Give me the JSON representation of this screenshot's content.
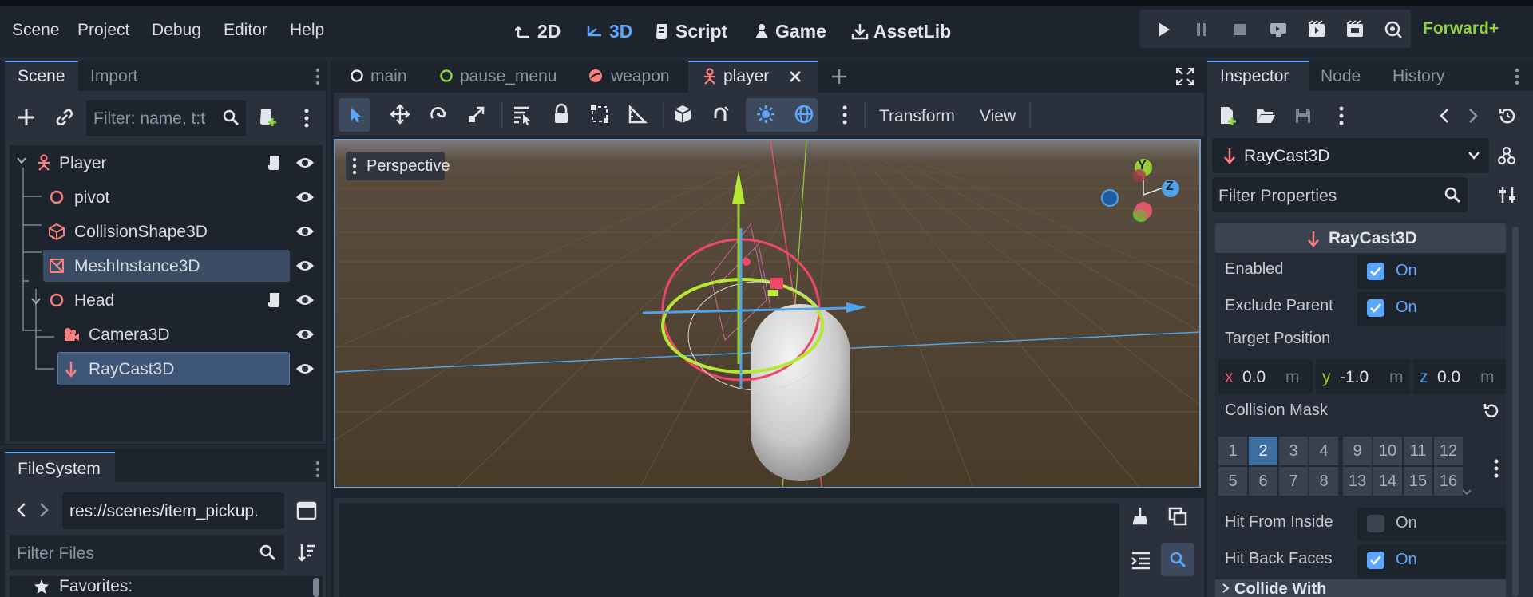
{
  "menu": [
    "Scene",
    "Project",
    "Debug",
    "Editor",
    "Help"
  ],
  "modes": {
    "m2d": "2D",
    "m3d": "3D",
    "script": "Script",
    "game": "Game",
    "assetlib": "AssetLib"
  },
  "renderer": "Forward+",
  "scene_dock": {
    "tabs": {
      "scene": "Scene",
      "import": "Import"
    },
    "filter_placeholder": "Filter: name, t:t",
    "nodes": [
      {
        "label": "Player",
        "icon": "character-body-icon"
      },
      {
        "label": "pivot",
        "icon": "node3d-icon"
      },
      {
        "label": "CollisionShape3D",
        "icon": "collision-shape-icon"
      },
      {
        "label": "MeshInstance3D",
        "icon": "mesh-instance-icon"
      },
      {
        "label": "Head",
        "icon": "node3d-icon"
      },
      {
        "label": "Camera3D",
        "icon": "camera-icon"
      },
      {
        "label": "RayCast3D",
        "icon": "raycast-icon"
      }
    ]
  },
  "filesystem": {
    "tab": "FileSystem",
    "path": "res://scenes/item_pickup.",
    "filter_placeholder": "Filter Files",
    "favorites": "Favorites:"
  },
  "scene_tabs": [
    {
      "label": "main"
    },
    {
      "label": "pause_menu"
    },
    {
      "label": "weapon"
    },
    {
      "label": "player"
    }
  ],
  "viewport": {
    "transform_menu": "Transform",
    "view_menu": "View",
    "perspective": "Perspective",
    "gizmo_axes": {
      "y": "Y",
      "z": "Z"
    }
  },
  "inspector": {
    "tabs": {
      "inspector": "Inspector",
      "node": "Node",
      "history": "History"
    },
    "node_type": "RayCast3D",
    "filter_placeholder": "Filter Properties",
    "section_title": "RayCast3D",
    "enabled": {
      "label": "Enabled",
      "value": "On",
      "checked": true
    },
    "exclude_parent": {
      "label": "Exclude Parent",
      "value": "On",
      "checked": true
    },
    "target_position": {
      "label": "Target Position",
      "x_label": "x",
      "x": "0.0",
      "y_label": "y",
      "y": "-1.0",
      "z_label": "z",
      "z": "0.0",
      "unit": "m"
    },
    "collision_mask": {
      "label": "Collision Mask",
      "layers": [
        "1",
        "2",
        "3",
        "4",
        "9",
        "10",
        "11",
        "12",
        "5",
        "6",
        "7",
        "8",
        "13",
        "14",
        "15",
        "16"
      ],
      "active": [
        "2"
      ]
    },
    "hit_from_inside": {
      "label": "Hit From Inside",
      "value": "On",
      "checked": false
    },
    "hit_back_faces": {
      "label": "Hit Back Faces",
      "value": "On",
      "checked": true
    },
    "collide_with": "Collide With"
  },
  "colors": {
    "accent": "#5ba7ff",
    "renderer": "#8fd33f",
    "node_red": "#fc7f7f"
  }
}
